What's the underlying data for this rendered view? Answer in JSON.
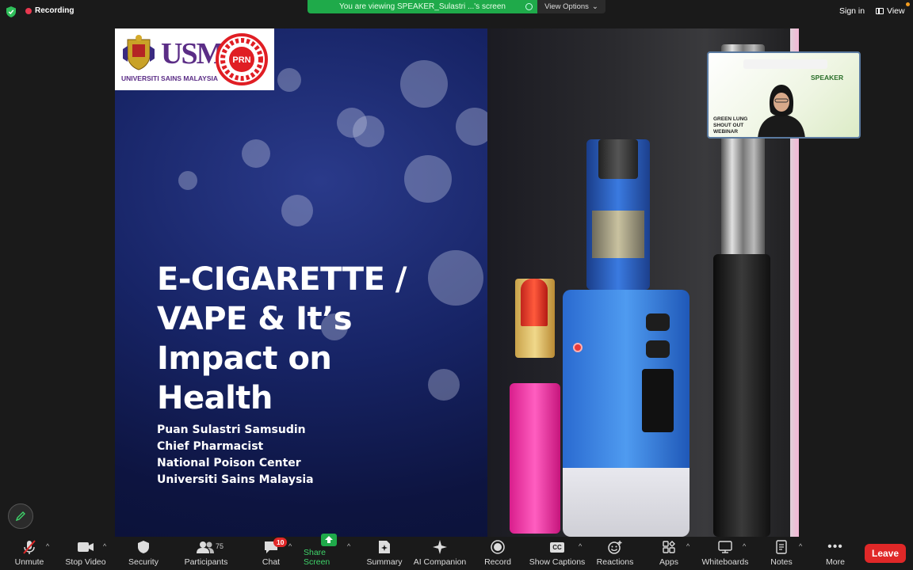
{
  "topbar": {
    "recording_label": "Recording",
    "viewing_banner": "You are viewing SPEAKER_Sulastri ...'s screen",
    "view_options": "View Options",
    "sign_in": "Sign in",
    "view": "View"
  },
  "slide": {
    "logo_usm": "USM",
    "logo_usm_sub": "UNIVERSITI SAINS MALAYSIA",
    "logo_prn": "PRN",
    "title_lines": [
      "E-CIGARETTE /",
      "VAPE & It’s",
      "Impact on",
      "Health"
    ],
    "author_lines": [
      "Puan Sulastri Samsudin",
      "Chief Pharmacist",
      "National Poison Center",
      "Universiti Sains Malaysia"
    ]
  },
  "speaker_tile": {
    "label": "SPEAKER",
    "webinar_lines": [
      "GREEN LUNG",
      "SHOUT OUT",
      "WEBINAR"
    ]
  },
  "toolbar": {
    "unmute": "Unmute",
    "stop_video": "Stop Video",
    "security": "Security",
    "participants": "Participants",
    "participants_count": "75",
    "chat": "Chat",
    "chat_badge": "10",
    "share_screen": "Share Screen",
    "summary": "Summary",
    "ai_companion": "AI Companion",
    "record": "Record",
    "show_captions": "Show Captions",
    "captions_icon_text": "CC",
    "reactions": "Reactions",
    "apps": "Apps",
    "whiteboards": "Whiteboards",
    "notes": "Notes",
    "more": "More",
    "leave": "Leave"
  },
  "colors": {
    "recording_dot": "#e8384f",
    "viewing_banner": "#1faa4a",
    "leave": "#e02828",
    "share_green": "#3fd46a"
  }
}
